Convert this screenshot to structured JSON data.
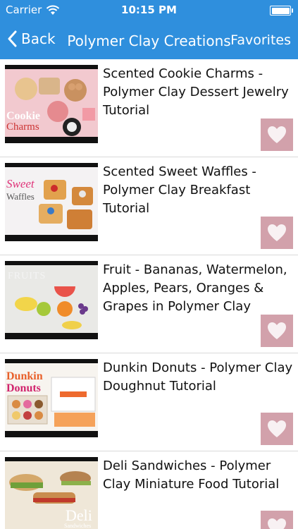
{
  "status_bar": {
    "carrier": "Carrier",
    "time": "10:15 PM",
    "wifi_icon": "wifi-icon",
    "battery_icon": "battery-icon"
  },
  "nav": {
    "back_label": "Back",
    "title": "Polymer Clay Creations",
    "favorites_label": "Favorites",
    "color": "#2f8fdd"
  },
  "items": [
    {
      "title": "Scented Cookie Charms - Polymer Clay Dessert Jewelry Tutorial",
      "thumb_text_1": "Cookie",
      "thumb_text_2": "Charms"
    },
    {
      "title": "Scented Sweet Waffles - Polymer Clay Breakfast Tutorial",
      "thumb_text_1": "Sweet",
      "thumb_text_2": "Waffles"
    },
    {
      "title": "Fruit - Bananas, Watermelon, Apples, Pears, Oranges & Grapes in Polymer Clay",
      "thumb_text_1": "FRUITS",
      "thumb_text_2": ""
    },
    {
      "title": "Dunkin Donuts - Polymer Clay Doughnut Tutorial",
      "thumb_text_1": "Dunkin",
      "thumb_text_2": "Donuts"
    },
    {
      "title": "Deli Sandwiches - Polymer Clay Miniature Food Tutorial",
      "thumb_text_1": "Deli",
      "thumb_text_2": "Sandwiches"
    }
  ],
  "favorite_button_color": "#d2a1ab",
  "heart_icon": "heart-icon"
}
